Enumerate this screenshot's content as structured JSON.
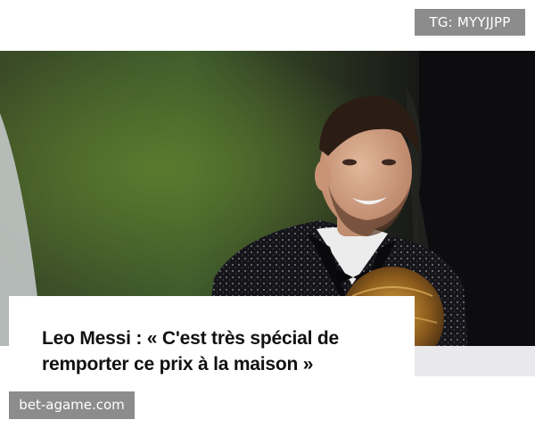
{
  "watermark": {
    "top_right": "TG: MYYJJPP",
    "bottom_left": "bet-agame.com"
  },
  "article": {
    "headline_line1": "Leo Messi : « C'est très spécial de",
    "headline_line2": "remporter ce prix à la maison »"
  },
  "colors": {
    "badge_bg": "#8c8c8c",
    "caption_bg": "#ffffff",
    "headline_text": "#111111"
  }
}
